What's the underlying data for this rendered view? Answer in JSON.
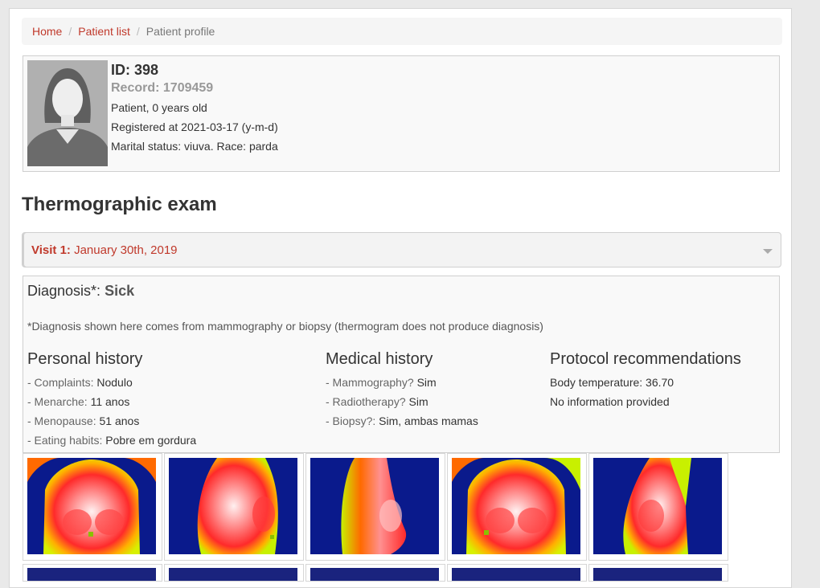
{
  "breadcrumb": {
    "home": "Home",
    "patient_list": "Patient list",
    "current": "Patient profile",
    "separator": "/"
  },
  "patient": {
    "id_label": "ID: 398",
    "record_label": "Record: 1709459",
    "age_line": "Patient, 0 years old",
    "registered_line": "Registered at 2021-03-17 (y-m-d)",
    "marital_line": "Marital status: viuva. Race: parda"
  },
  "exam": {
    "title": "Thermographic exam",
    "visit_label": "Visit 1:",
    "visit_date": "January 30th, 2019"
  },
  "diagnosis": {
    "label": "Diagnosis*:",
    "value": "Sick",
    "note": "*Diagnosis shown here comes from mammography or biopsy (thermogram does not produce diagnosis)"
  },
  "personal_history": {
    "title": "Personal history",
    "items": [
      {
        "label": "- Complaints:",
        "value": "Nodulo"
      },
      {
        "label": "- Menarche:",
        "value": "11 anos"
      },
      {
        "label": "- Menopause:",
        "value": "51 anos"
      },
      {
        "label": "- Eating habits:",
        "value": "Pobre em gordura"
      }
    ]
  },
  "medical_history": {
    "title": "Medical history",
    "items": [
      {
        "label": "- Mammography?",
        "value": "Sim"
      },
      {
        "label": "- Radiotherapy?",
        "value": "Sim"
      },
      {
        "label": "- Biopsy?:",
        "value": "Sim, ambas mamas"
      }
    ]
  },
  "protocol": {
    "title": "Protocol recommendations",
    "body_temperature": "Body temperature: 36.70",
    "info": "No information provided"
  },
  "thermograms": [
    {
      "view": "frontal"
    },
    {
      "view": "right-lateral"
    },
    {
      "view": "left-lateral"
    },
    {
      "view": "frontal-2"
    },
    {
      "view": "left-oblique"
    }
  ],
  "colors": {
    "accent": "#c0392b",
    "thermal_background": "#0a1a8c"
  }
}
